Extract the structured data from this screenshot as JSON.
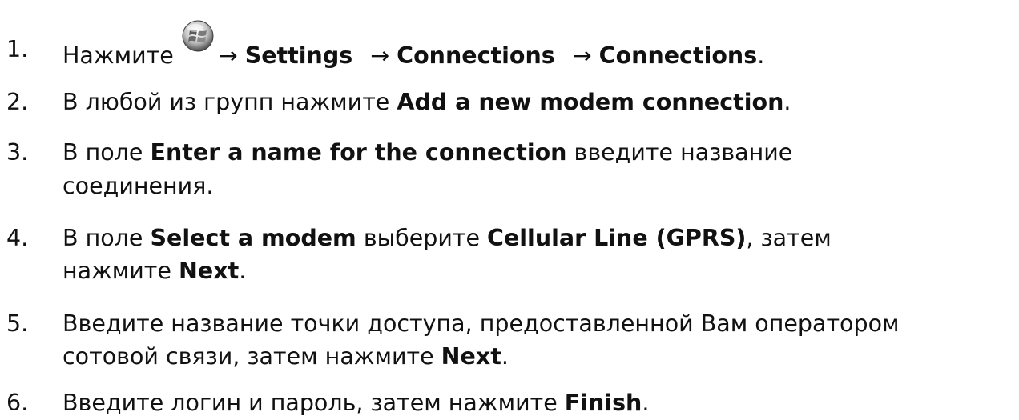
{
  "steps": [
    {
      "number": "1.",
      "press": "Нажмите",
      "start_icon": "windows-start-button-icon",
      "arrow1": "→",
      "settings": "Settings",
      "arrow2": "→",
      "connections1": "Connections",
      "arrow3": "→",
      "connections2": "Connections",
      "end": "."
    },
    {
      "number": "2.",
      "pre": "В любой из групп нажмите ",
      "bold": "Add a new modem connection",
      "end": "."
    },
    {
      "number": "3.",
      "pre": "В поле ",
      "bold": "Enter a name for the connection",
      "post": " введите название",
      "line2": "соединения."
    },
    {
      "number": "4.",
      "pre": "В поле ",
      "bold1": "Select a modem",
      "mid": " выберите ",
      "bold2": "Cellular Line (GPRS)",
      "post": ", затем",
      "line2_pre": "нажмите ",
      "line2_bold": "Next",
      "line2_end": "."
    },
    {
      "number": "5.",
      "line1": "Введите название точки доступа, предоставленной Вам оператором",
      "line2_pre": "сотовой связи, затем нажмите ",
      "line2_bold": "Next",
      "line2_end": "."
    },
    {
      "number": "6.",
      "pre": "Введите логин и пароль, затем нажмите ",
      "bold": "Finish",
      "end": "."
    }
  ]
}
